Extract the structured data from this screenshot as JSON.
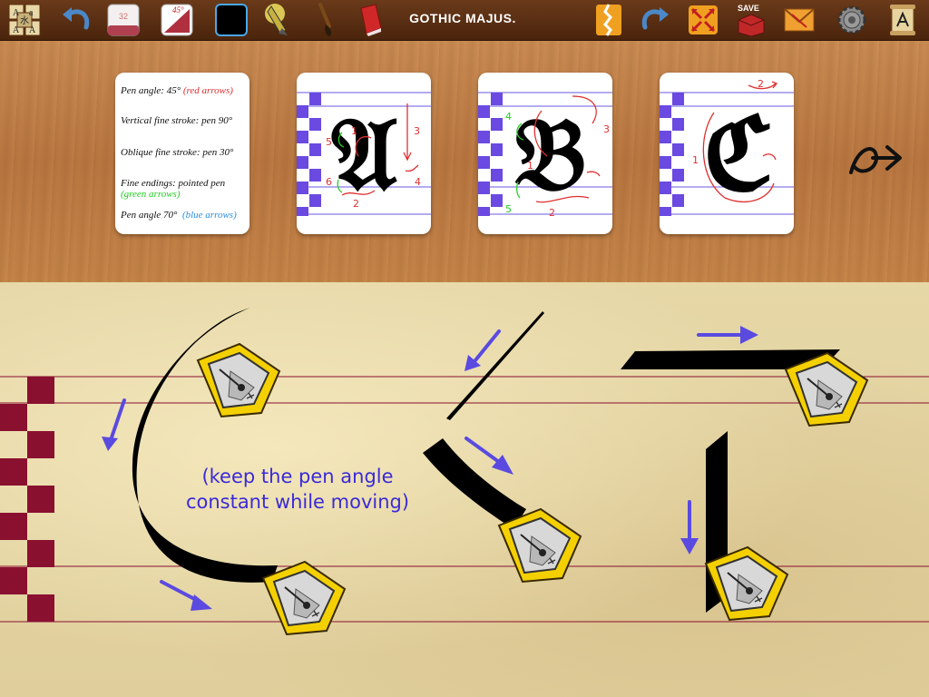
{
  "toolbar": {
    "title": "GOTHIC MAJUS.",
    "pen_size": "32",
    "pen_angle": "45°",
    "save_label": "SAVE",
    "icons": [
      "alphabet-grid-icon",
      "undo-icon",
      "pen-size-icon",
      "pen-angle-icon",
      "ink-color-icon",
      "nib-pen-icon",
      "brush-icon",
      "eraser-icon",
      "torn-page-icon",
      "redo-icon",
      "fullscreen-icon",
      "save-icon",
      "email-icon",
      "settings-icon",
      "scroll-icon"
    ]
  },
  "legend": {
    "pen_angle": "Pen angle: 45°",
    "red_arrows": "(red arrows)",
    "vertical": "Vertical fine stroke: pen 90°",
    "oblique": "Oblique fine stroke: pen 30°",
    "fine_endings": "Fine endings: pointed pen",
    "green_arrows": "(green arrows)",
    "pen_angle_70": "Pen angle 70°",
    "blue_arrows": "(blue arrows)"
  },
  "letters": [
    {
      "glyph": "A",
      "strokes": [
        "1",
        "2",
        "3",
        "4",
        "5",
        "6"
      ]
    },
    {
      "glyph": "B",
      "strokes": [
        "1",
        "2",
        "3",
        "4",
        "5"
      ]
    },
    {
      "glyph": "C",
      "strokes": [
        "1",
        "2"
      ]
    }
  ],
  "sheet": {
    "instruction": "(keep the pen angle constant while moving)"
  },
  "colors": {
    "toolbar": "#4a240c",
    "wood": "#c08048",
    "stroke_arrow": "#e03030",
    "green_arrow": "#22cc22",
    "blue_arrow": "#5a4ae0",
    "guide_line": "#8a1030",
    "checker": "#8a1030",
    "card_checker": "#6a4ae0",
    "instruction": "#3a2ad8"
  }
}
